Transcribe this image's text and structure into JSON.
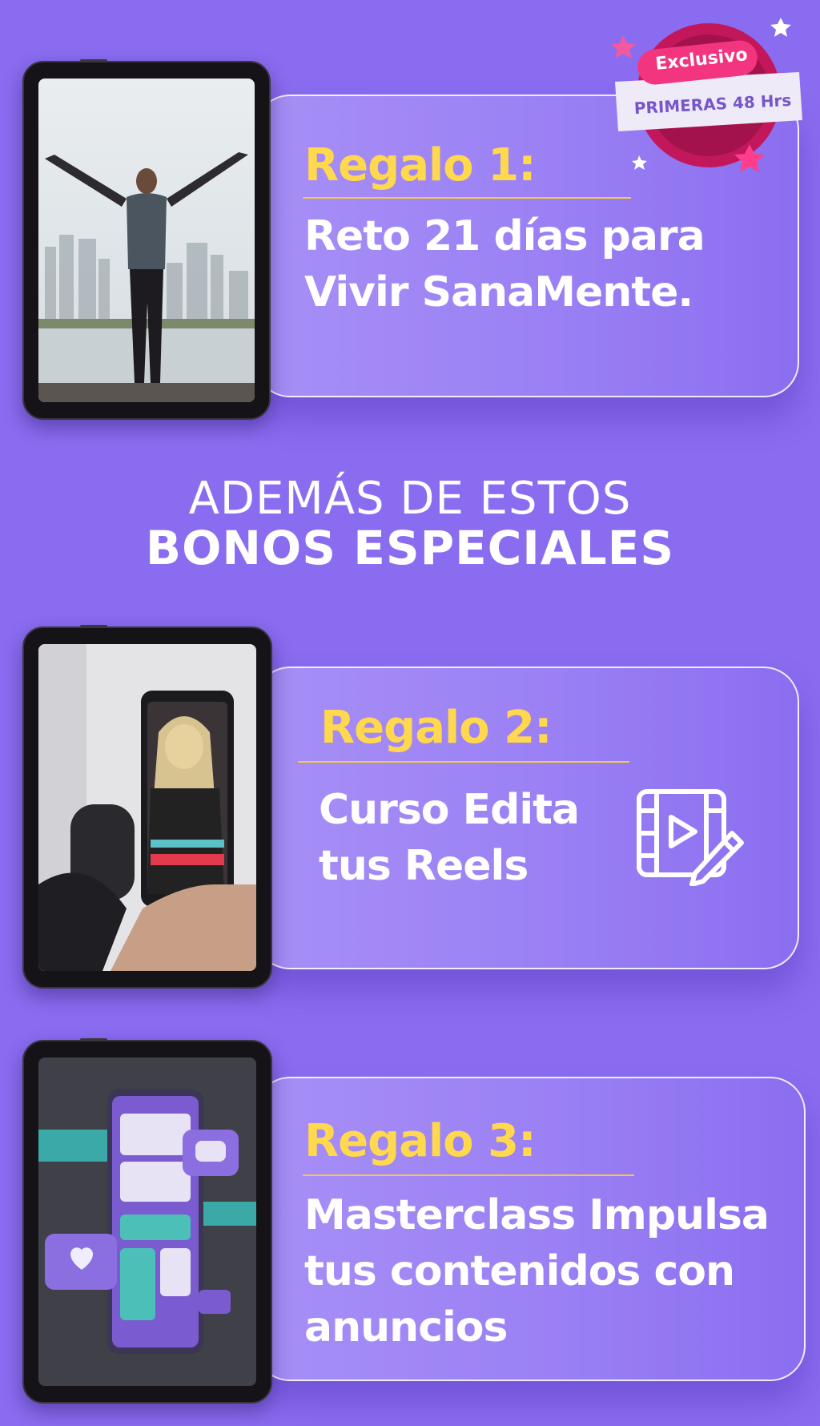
{
  "badge": {
    "top_label": "Exclusivo",
    "ribbon_label": "PRIMERAS 48 Hrs"
  },
  "gifts": [
    {
      "title": "Regalo 1:",
      "desc_line1": "Reto 21 días para",
      "desc_line2": "Vivir SanaMente.",
      "desc_line3": ""
    },
    {
      "title": "Regalo 2:",
      "desc_line1": "Curso Edita",
      "desc_line2": "tus Reels",
      "desc_line3": ""
    },
    {
      "title": "Regalo 3:",
      "desc_line1": "Masterclass Impulsa",
      "desc_line2": "tus contenidos con",
      "desc_line3": "anuncios"
    }
  ],
  "section": {
    "line1": "ADEMÁS DE ESTOS",
    "line2": "BONOS ESPECIALES"
  },
  "colors": {
    "background": "#8a6cf0",
    "accent_yellow": "#ffd84d",
    "badge_pink": "#f2357e",
    "badge_ring": "#c2185b"
  },
  "icons": {
    "video_edit": "video-edit-icon"
  }
}
